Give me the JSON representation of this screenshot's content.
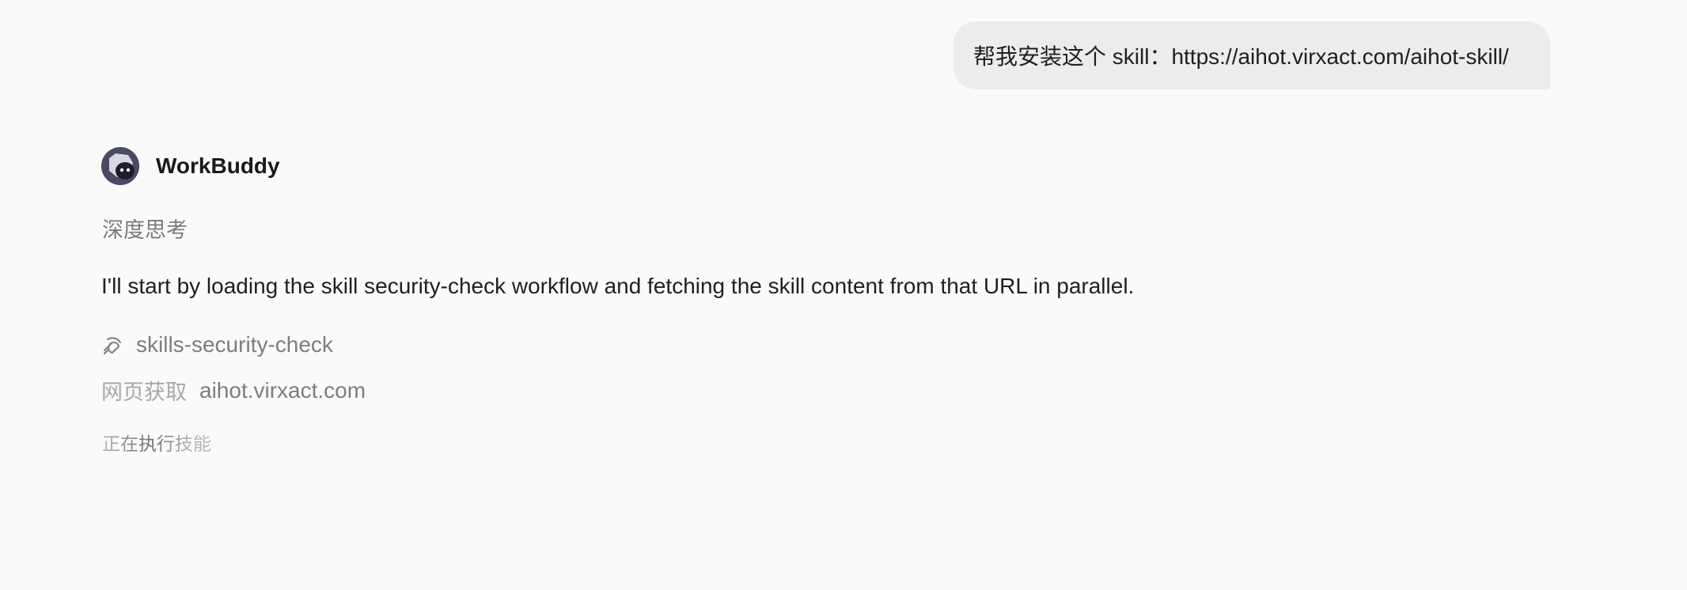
{
  "user_message": {
    "text": "帮我安装这个 skill：https://aihot.virxact.com/aihot-skill/"
  },
  "assistant": {
    "name": "WorkBuddy",
    "avatar_icon": "robot-avatar-icon",
    "thinking_label": "深度思考",
    "message": "I'll start by loading the skill security-check workflow and fetching the skill content from that URL in parallel.",
    "tools": {
      "skill": {
        "icon": "skill-icon",
        "name": "skills-security-check"
      },
      "fetch": {
        "label": "网页获取",
        "domain": "aihot.virxact.com"
      }
    },
    "status": "正在执行技能"
  },
  "colors": {
    "background": "#fafafa",
    "user_bubble": "#ececec",
    "avatar_bg": "#4a4a63",
    "muted_text": "#7d7d7d"
  }
}
